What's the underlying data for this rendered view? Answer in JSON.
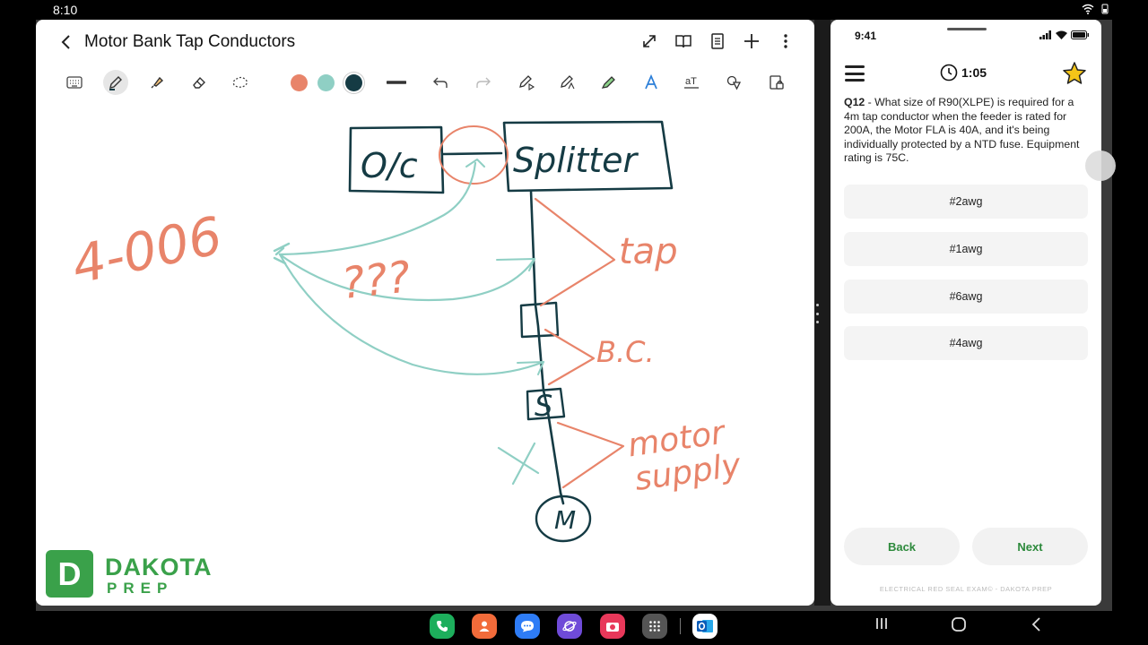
{
  "status_bar": {
    "time": "8:10"
  },
  "notes": {
    "title": "Motor Bank Tap Conductors",
    "top_icons": [
      "expand-icon",
      "book-icon",
      "page-icon",
      "add-icon",
      "more-icon"
    ],
    "tools": [
      "keyboard-icon",
      "pen-icon",
      "highlighter-icon",
      "eraser-icon",
      "lasso-icon",
      "line-thickness-icon",
      "undo-icon",
      "redo-icon",
      "shape-pen-icon",
      "text-pen-icon",
      "highlighter-green-icon",
      "text-style-icon",
      "text-recognize-icon",
      "shapes-icon",
      "lock-icon"
    ],
    "colors": {
      "coral": "#E8846A",
      "teal": "#8FCFC4",
      "navy": "#153B44"
    },
    "drawing": {
      "code": "4-006",
      "oc": "O/c",
      "splitter": "Splitter",
      "question": "???",
      "tap": "tap",
      "bc": "B.C.",
      "s": "S",
      "motor_supply_1": "motor",
      "motor_supply_2": "supply",
      "m": "M"
    },
    "logo": {
      "line1": "DAKOTA",
      "line2": "PREP",
      "mark": "D"
    }
  },
  "phone": {
    "time": "9:41",
    "timer": "1:05",
    "question_num": "Q12",
    "question_text": " - What size of R90(XLPE) is required for a 4m tap conductor when the feeder is rated for 200A, the Motor FLA is 40A, and it's being individually protected by a NTD fuse. Equipment rating is 75C.",
    "options": [
      "#2awg",
      "#1awg",
      "#6awg",
      "#4awg"
    ],
    "back": "Back",
    "next": "Next",
    "footer": "ELECTRICAL RED SEAL EXAM© - DAKOTA PREP"
  },
  "taskbar": {
    "apps": [
      "phone-app",
      "contacts-app",
      "messages-app",
      "internet-app",
      "camera-app",
      "apps-grid",
      "outlook-app"
    ],
    "nav": [
      "recents-button",
      "home-button",
      "back-button"
    ]
  }
}
